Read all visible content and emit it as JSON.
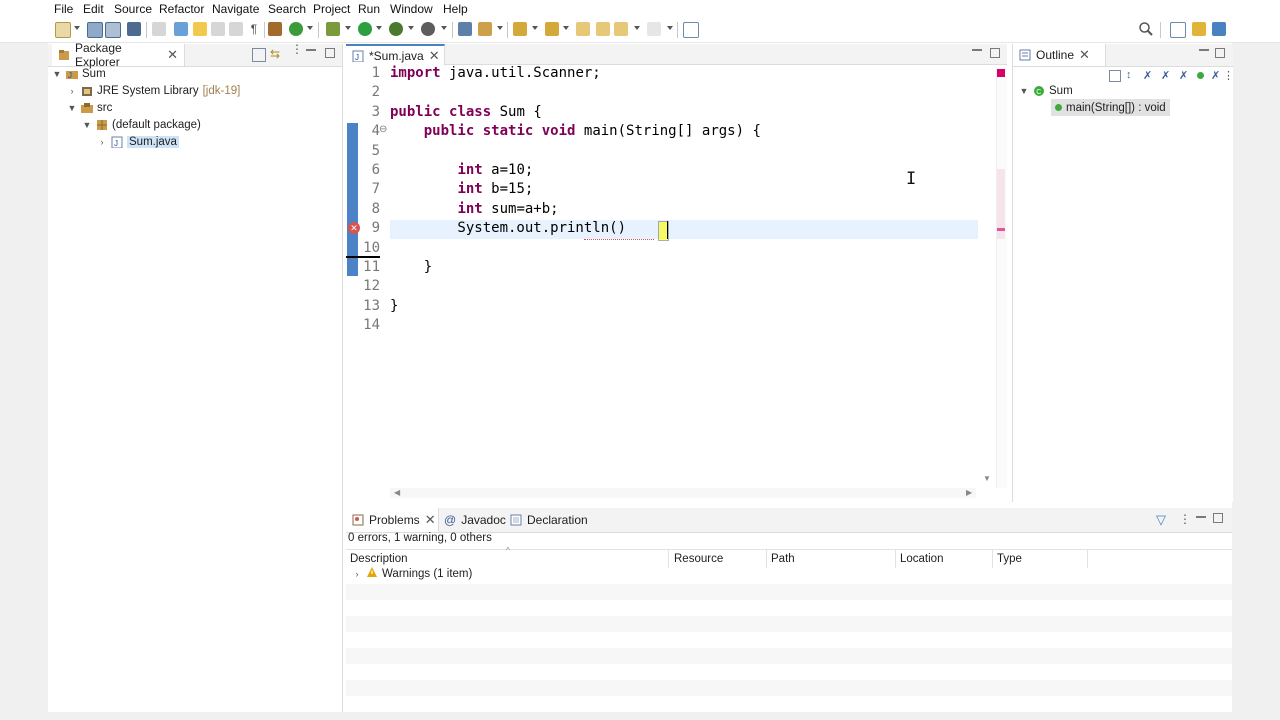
{
  "menu": [
    "File",
    "Edit",
    "Source",
    "Refactor",
    "Navigate",
    "Search",
    "Project",
    "Run",
    "Window",
    "Help"
  ],
  "package_explorer": {
    "tab_label": "Package Explorer",
    "tree": [
      {
        "label": "Sum",
        "level": 0,
        "expanded": true
      },
      {
        "label": "JRE System Library",
        "suffix": "[jdk-19]",
        "level": 1,
        "expanded": false
      },
      {
        "label": "src",
        "level": 1,
        "expanded": true
      },
      {
        "label": "(default package)",
        "level": 2,
        "expanded": true
      },
      {
        "label": "Sum.java",
        "level": 3,
        "expanded": false,
        "selected": true
      }
    ]
  },
  "editor": {
    "tab_label": "*Sum.java",
    "line_numbers": [
      "1",
      "2",
      "3",
      "4",
      "5",
      "6",
      "7",
      "8",
      "9",
      "10",
      "11",
      "12",
      "13",
      "14"
    ],
    "lines": [
      [
        {
          "t": "import",
          "k": 1
        },
        {
          "t": " java.util.Scanner;"
        }
      ],
      [],
      [
        {
          "t": "public",
          "k": 1
        },
        {
          "t": " "
        },
        {
          "t": "class",
          "k": 1
        },
        {
          "t": " Sum {"
        }
      ],
      [
        {
          "t": "    "
        },
        {
          "t": "public",
          "k": 1
        },
        {
          "t": " "
        },
        {
          "t": "static",
          "k": 1
        },
        {
          "t": " "
        },
        {
          "t": "void",
          "k": 1
        },
        {
          "t": " main(String[] args) {"
        }
      ],
      [],
      [
        {
          "t": "        "
        },
        {
          "t": "int",
          "k": 1
        },
        {
          "t": " a=10;"
        }
      ],
      [
        {
          "t": "        "
        },
        {
          "t": "int",
          "k": 1
        },
        {
          "t": " b=15;"
        }
      ],
      [
        {
          "t": "        "
        },
        {
          "t": "int",
          "k": 1
        },
        {
          "t": " sum=a+b;"
        }
      ],
      [
        {
          "t": "        System.out.println()"
        }
      ],
      [],
      [
        {
          "t": "    }"
        }
      ],
      [],
      [
        {
          "t": "}"
        }
      ],
      []
    ],
    "error_line": "9",
    "current_line": "9"
  },
  "outline": {
    "tab_label": "Outline",
    "class_label": "Sum",
    "method_label": "main(String[]) : void"
  },
  "problems": {
    "tabs": [
      "Problems",
      "Javadoc",
      "Declaration"
    ],
    "summary": "0 errors, 1 warning, 0 others",
    "columns": [
      "Description",
      "Resource",
      "Path",
      "Location",
      "Type"
    ],
    "rows": [
      {
        "description": "Warnings (1 item)"
      }
    ]
  },
  "colors": {
    "keyword": "#7f0055",
    "selection": "#cfe3f7",
    "error": "#d9534f",
    "warning": "#e2a800"
  }
}
